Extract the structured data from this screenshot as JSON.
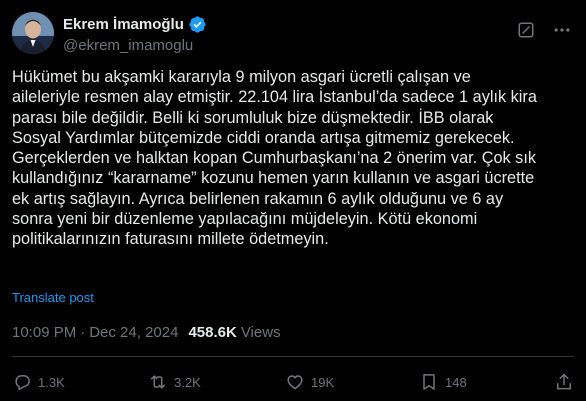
{
  "author": {
    "display_name": "Ekrem İmamoğlu",
    "handle": "@ekrem_imamoglu",
    "verified": true
  },
  "icons": {
    "verified": "verified-badge-icon",
    "grok": "grok-icon",
    "more": "more-icon",
    "reply": "reply-icon",
    "repost": "repost-icon",
    "like": "like-icon",
    "bookmark": "bookmark-icon",
    "share": "share-icon"
  },
  "tweet": {
    "text": "Hükümet bu akşamki kararıyla 9 milyon asgari ücretli çalışan ve\naileleriyle resmen alay etmiştir. 22.104 lira İstanbul’da sadece 1 aylık kira\nparası bile değildir. Belli ki sorumluluk bize düşmektedir. İBB olarak\nSosyal Yardımlar bütçemizde ciddi oranda artışa gitmemiz gerekecek.\nGerçeklerden ve halktan kopan Cumhurbaşkanı’na 2 önerim var. Çok sık\nkullandığınız “kararname” kozunu hemen yarın kullanın ve asgari ücrette\nek artış sağlayın. Ayrıca belirlenen rakamın 6 aylık olduğunu ve 6 ay\nsonra yeni bir düzenleme yapılacağını müjdeleyin. Kötü ekonomi\npolitikalarınızın faturasını millete ödetmeyin.",
    "translate_label": "Translate post",
    "time": "10:09 PM",
    "separator": "·",
    "date": "Dec 24, 2024",
    "views_count": "458.6K",
    "views_label": "Views"
  },
  "actions": {
    "replies": "1.3K",
    "reposts": "3.2K",
    "likes": "19K",
    "bookmarks": "148"
  },
  "colors": {
    "background": "#000000",
    "text": "#e7e9ea",
    "muted": "#71767b",
    "link": "#1d9bf0",
    "verified": "#1d9bf0",
    "divider": "#2f3336"
  }
}
